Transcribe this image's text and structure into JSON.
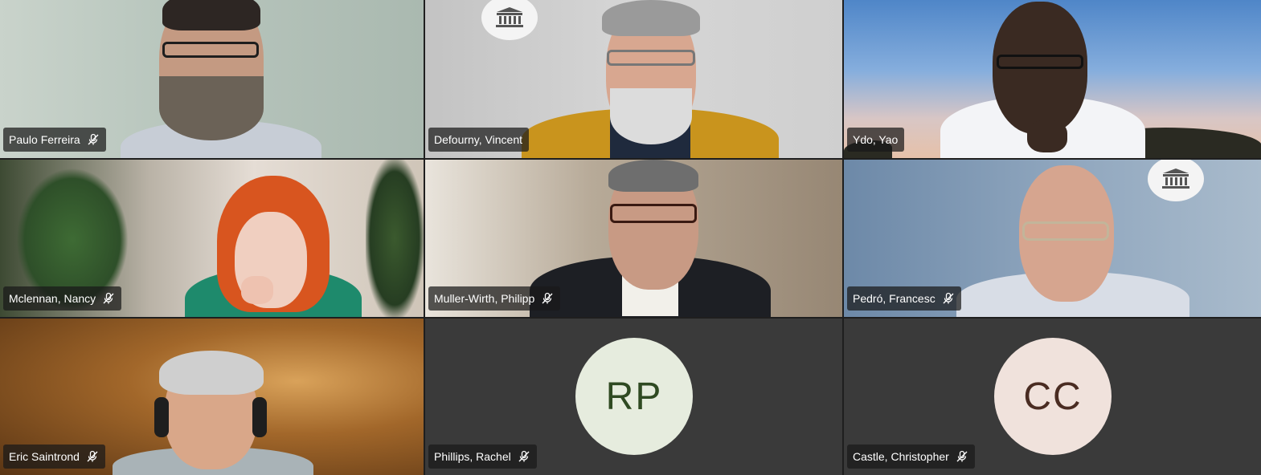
{
  "participants": [
    {
      "name": "Paulo Ferreira",
      "muted": true
    },
    {
      "name": "Defourny, Vincent",
      "muted": false
    },
    {
      "name": "Ydo, Yao",
      "muted": false
    },
    {
      "name": "Mclennan, Nancy",
      "muted": true
    },
    {
      "name": "Muller-Wirth, Philipp",
      "muted": true
    },
    {
      "name": "Pedró, Francesc",
      "muted": true
    },
    {
      "name": "Eric Saintrond",
      "muted": true
    },
    {
      "name": "Phillips, Rachel",
      "muted": true,
      "initials": "RP"
    },
    {
      "name": "Castle, Christopher",
      "muted": true,
      "initials": "CC"
    }
  ],
  "icons": {
    "mic_muted": "mic-muted-icon",
    "logo": "unesco-logo-icon"
  },
  "colors": {
    "tile_empty": "#3a3a3a",
    "avatar_rp_bg": "#e6ecde",
    "avatar_rp_text": "#2f4a22",
    "avatar_cc_bg": "#f0e2dc",
    "avatar_cc_text": "#4a2c22"
  }
}
